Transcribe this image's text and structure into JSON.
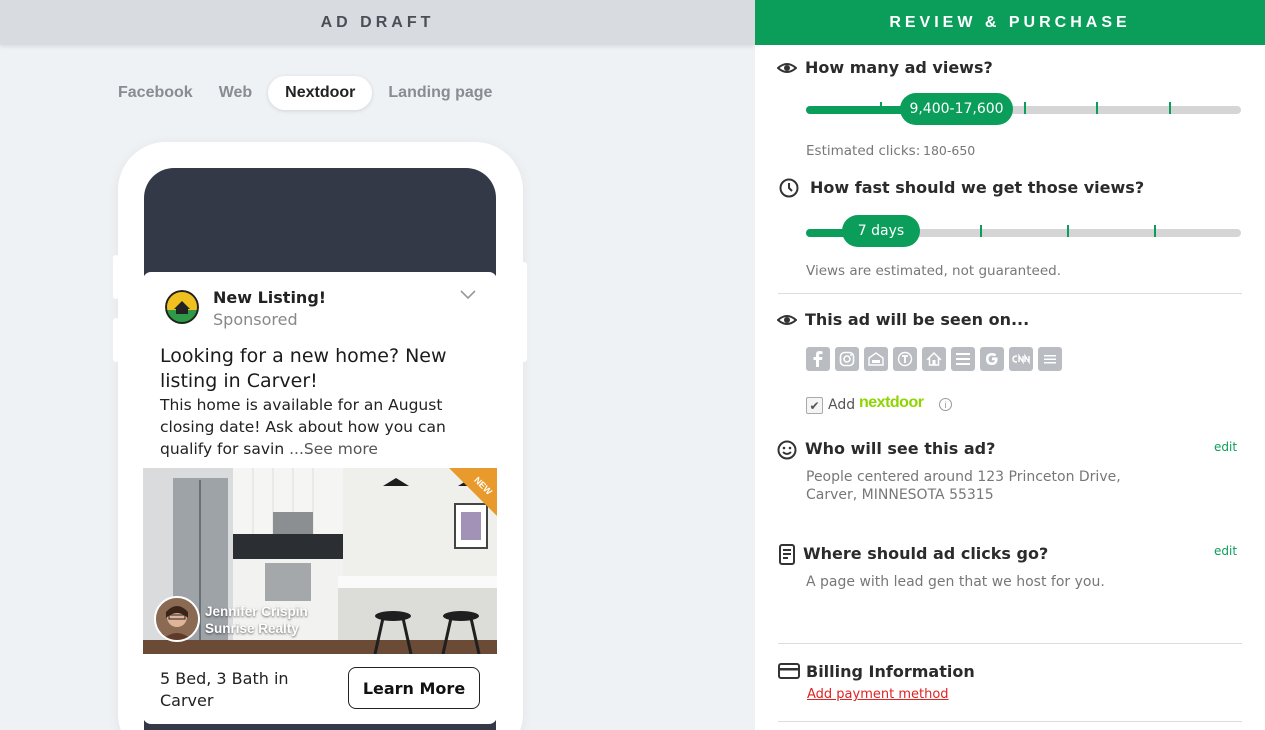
{
  "left": {
    "header": "AD DRAFT",
    "tabs": [
      {
        "label": "Facebook",
        "active": false
      },
      {
        "label": "Web",
        "active": false
      },
      {
        "label": "Nextdoor",
        "active": true
      },
      {
        "label": "Landing page",
        "active": false
      }
    ],
    "ad": {
      "title": "New Listing!",
      "sponsored": "Sponsored",
      "headline": "Looking for a new home? New listing in Carver!",
      "body": "This home is available for an August closing date! Ask about how you can qualify for savin",
      "see_more": " ...See more",
      "ribbon": "NEW",
      "agent_name": "Jennifer Crispin",
      "agent_company": "Sunrise Realty",
      "footer_text": "5 Bed, 3 Bath in Carver",
      "cta": "Learn More"
    }
  },
  "right": {
    "header": "REVIEW & PURCHASE",
    "views": {
      "title": "How many ad views?",
      "selected": "9,400-17,600",
      "clicks_label": "Estimated clicks:",
      "clicks_value": "180-650"
    },
    "speed": {
      "title": "How fast should we get those views?",
      "selected": "7 days",
      "note": "Views are estimated, not guaranteed."
    },
    "seen_on": {
      "title": "This ad will be seen on...",
      "platforms": [
        "facebook-icon",
        "instagram-icon",
        "hgtv-icon",
        "nytimes-icon",
        "zillow-icon",
        "weather-channel-icon",
        "google-icon",
        "cnn-icon",
        "other-site-icon"
      ],
      "add_label": "Add",
      "nextdoor": "nextdoor"
    },
    "audience": {
      "title": "Who will see this ad?",
      "edit": "edit",
      "desc": "People centered around 123 Princeton Drive, Carver, MINNESOTA 55315"
    },
    "clicks": {
      "title": "Where should ad clicks go?",
      "edit": "edit",
      "desc": "A page with lead gen that we host for you."
    },
    "billing": {
      "title": "Billing Information",
      "link": "Add payment method"
    }
  },
  "colors": {
    "accent": "#0a9e5a",
    "error": "#e02222",
    "nextdoor": "#8ed500"
  }
}
